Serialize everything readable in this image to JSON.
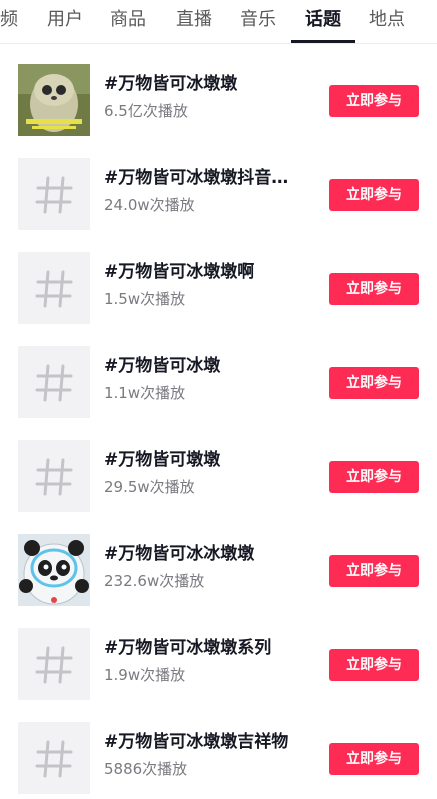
{
  "tabs": [
    {
      "label": "频",
      "active": false
    },
    {
      "label": "用户",
      "active": false
    },
    {
      "label": "商品",
      "active": false
    },
    {
      "label": "直播",
      "active": false
    },
    {
      "label": "音乐",
      "active": false
    },
    {
      "label": "话题",
      "active": true
    },
    {
      "label": "地点",
      "active": false
    }
  ],
  "join_label": "立即参与",
  "accent_color": "#fe2c55",
  "topics": [
    {
      "title": "#万物皆可冰墩墩",
      "plays": "6.5亿次播放",
      "thumb": "image",
      "thumb_caption": ""
    },
    {
      "title": "#万物皆可冰墩墩抖音助…",
      "plays": "24.0w次播放",
      "thumb": "hashtag-icon"
    },
    {
      "title": "#万物皆可冰墩墩啊",
      "plays": "1.5w次播放",
      "thumb": "hashtag-icon"
    },
    {
      "title": "#万物皆可冰墩",
      "plays": "1.1w次播放",
      "thumb": "hashtag-icon"
    },
    {
      "title": "#万物皆可墩墩",
      "plays": "29.5w次播放",
      "thumb": "hashtag-icon"
    },
    {
      "title": "#万物皆可冰冰墩墩",
      "plays": "232.6w次播放",
      "thumb": "panda-image"
    },
    {
      "title": "#万物皆可冰墩墩系列",
      "plays": "1.9w次播放",
      "thumb": "hashtag-icon"
    },
    {
      "title": "#万物皆可冰墩墩吉祥物",
      "plays": "5886次播放",
      "thumb": "hashtag-icon"
    }
  ]
}
